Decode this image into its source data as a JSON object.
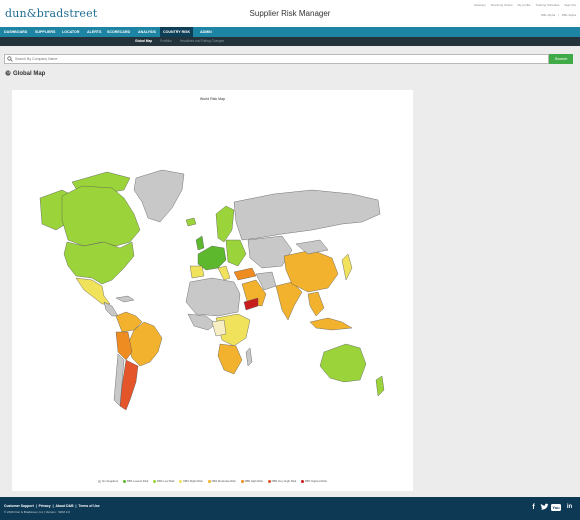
{
  "header": {
    "logo_text": "dun&bradstreet",
    "app_title": "Supplier Risk Manager",
    "utility_links": [
      "Glossary",
      "Scanning Online",
      "My profile",
      "Training Schedule",
      "Sign Out"
    ],
    "user_links": [
      "DBL Alpha",
      "DBL Alpha"
    ]
  },
  "nav": {
    "items": [
      {
        "label": "DASHBOARD",
        "active": false
      },
      {
        "label": "SUPPLIERS",
        "active": false
      },
      {
        "label": "LOCATOR",
        "active": false
      },
      {
        "label": "ALERTS",
        "active": false
      },
      {
        "label": "SCORECARD",
        "active": false
      },
      {
        "label": "ANALYSIS",
        "active": false
      },
      {
        "label": "COUNTRY RISK",
        "active": true
      },
      {
        "label": "ADMIN",
        "active": false
      }
    ]
  },
  "subnav": {
    "items": [
      {
        "label": "Global Map",
        "active": true
      },
      {
        "label": "Portfolio",
        "active": false
      },
      {
        "label": "Headlines and Rating Changes",
        "active": false
      }
    ]
  },
  "search": {
    "placeholder": "Search By Company Name",
    "button_label": "Search"
  },
  "page": {
    "title": "Global Map"
  },
  "map": {
    "title": "World Risk Map",
    "legend": [
      {
        "label": "No Suppliers",
        "color": "#c8c8c8"
      },
      {
        "label": "DB1 Lowest Risk",
        "color": "#5eb82e"
      },
      {
        "label": "DB2 Low Risk",
        "color": "#9ad43a"
      },
      {
        "label": "DB3 Slight Risk",
        "color": "#f0e25a"
      },
      {
        "label": "DB4 Moderate Risk",
        "color": "#f3b22e"
      },
      {
        "label": "DB5 High Risk",
        "color": "#ee8c22"
      },
      {
        "label": "DB6 Very High Risk",
        "color": "#e4552a"
      },
      {
        "label": "DB7 Highest Risk",
        "color": "#c81e1e"
      }
    ],
    "region_colors": {
      "none": "#c8c8c8",
      "db1": "#5eb82e",
      "db2": "#9ad43a",
      "db3": "#f0e25a",
      "db4": "#f3b22e",
      "db5": "#ee8c22",
      "db6": "#e4552a",
      "db7": "#c81e1e"
    }
  },
  "footer": {
    "links": [
      "Customer Support",
      "Privacy",
      "About D&B",
      "Terms of Use"
    ],
    "copyright": "© 2016 Dun & Bradstreet, Inc",
    "version": "Version : SRM 2.0",
    "social": [
      "facebook-icon",
      "twitter-icon",
      "youtube-icon",
      "linkedin-icon"
    ]
  },
  "colors": {
    "nav_bg": "#1d84a3",
    "nav_active": "#0f3e57",
    "subnav_bg": "#24323c",
    "footer_bg": "#0e3954",
    "search_button": "#3faa46"
  }
}
